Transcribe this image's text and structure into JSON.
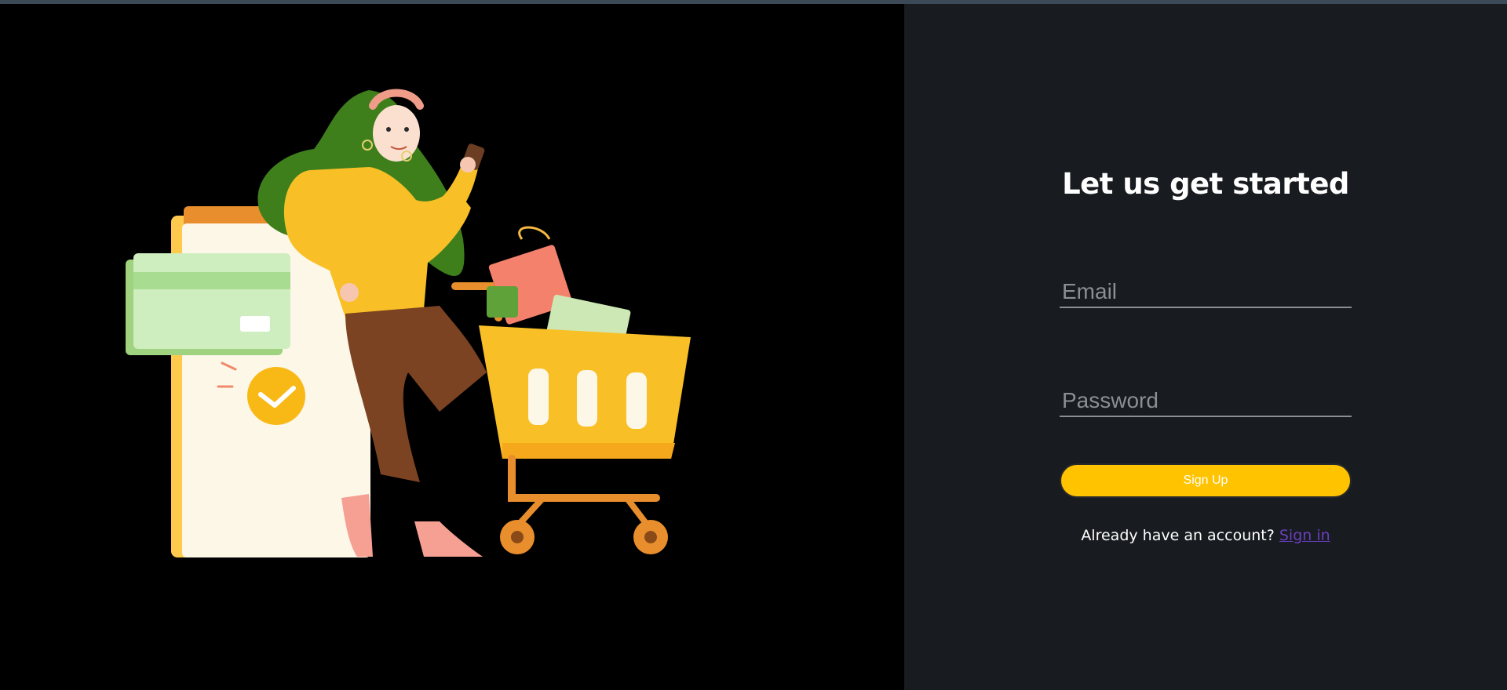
{
  "form": {
    "title": "Let us get started",
    "email": {
      "placeholder": "Email",
      "value": ""
    },
    "password": {
      "placeholder": "Password",
      "value": ""
    },
    "signup_label": "Sign Up",
    "signin_prompt": "Already have an account?",
    "signin_link": "Sign in"
  },
  "colors": {
    "left_background": "#000000",
    "right_background": "#181b1f",
    "accent": "#ffc300",
    "link": "#6a3fbf"
  },
  "illustration": {
    "icon": "shopping-illustration"
  }
}
